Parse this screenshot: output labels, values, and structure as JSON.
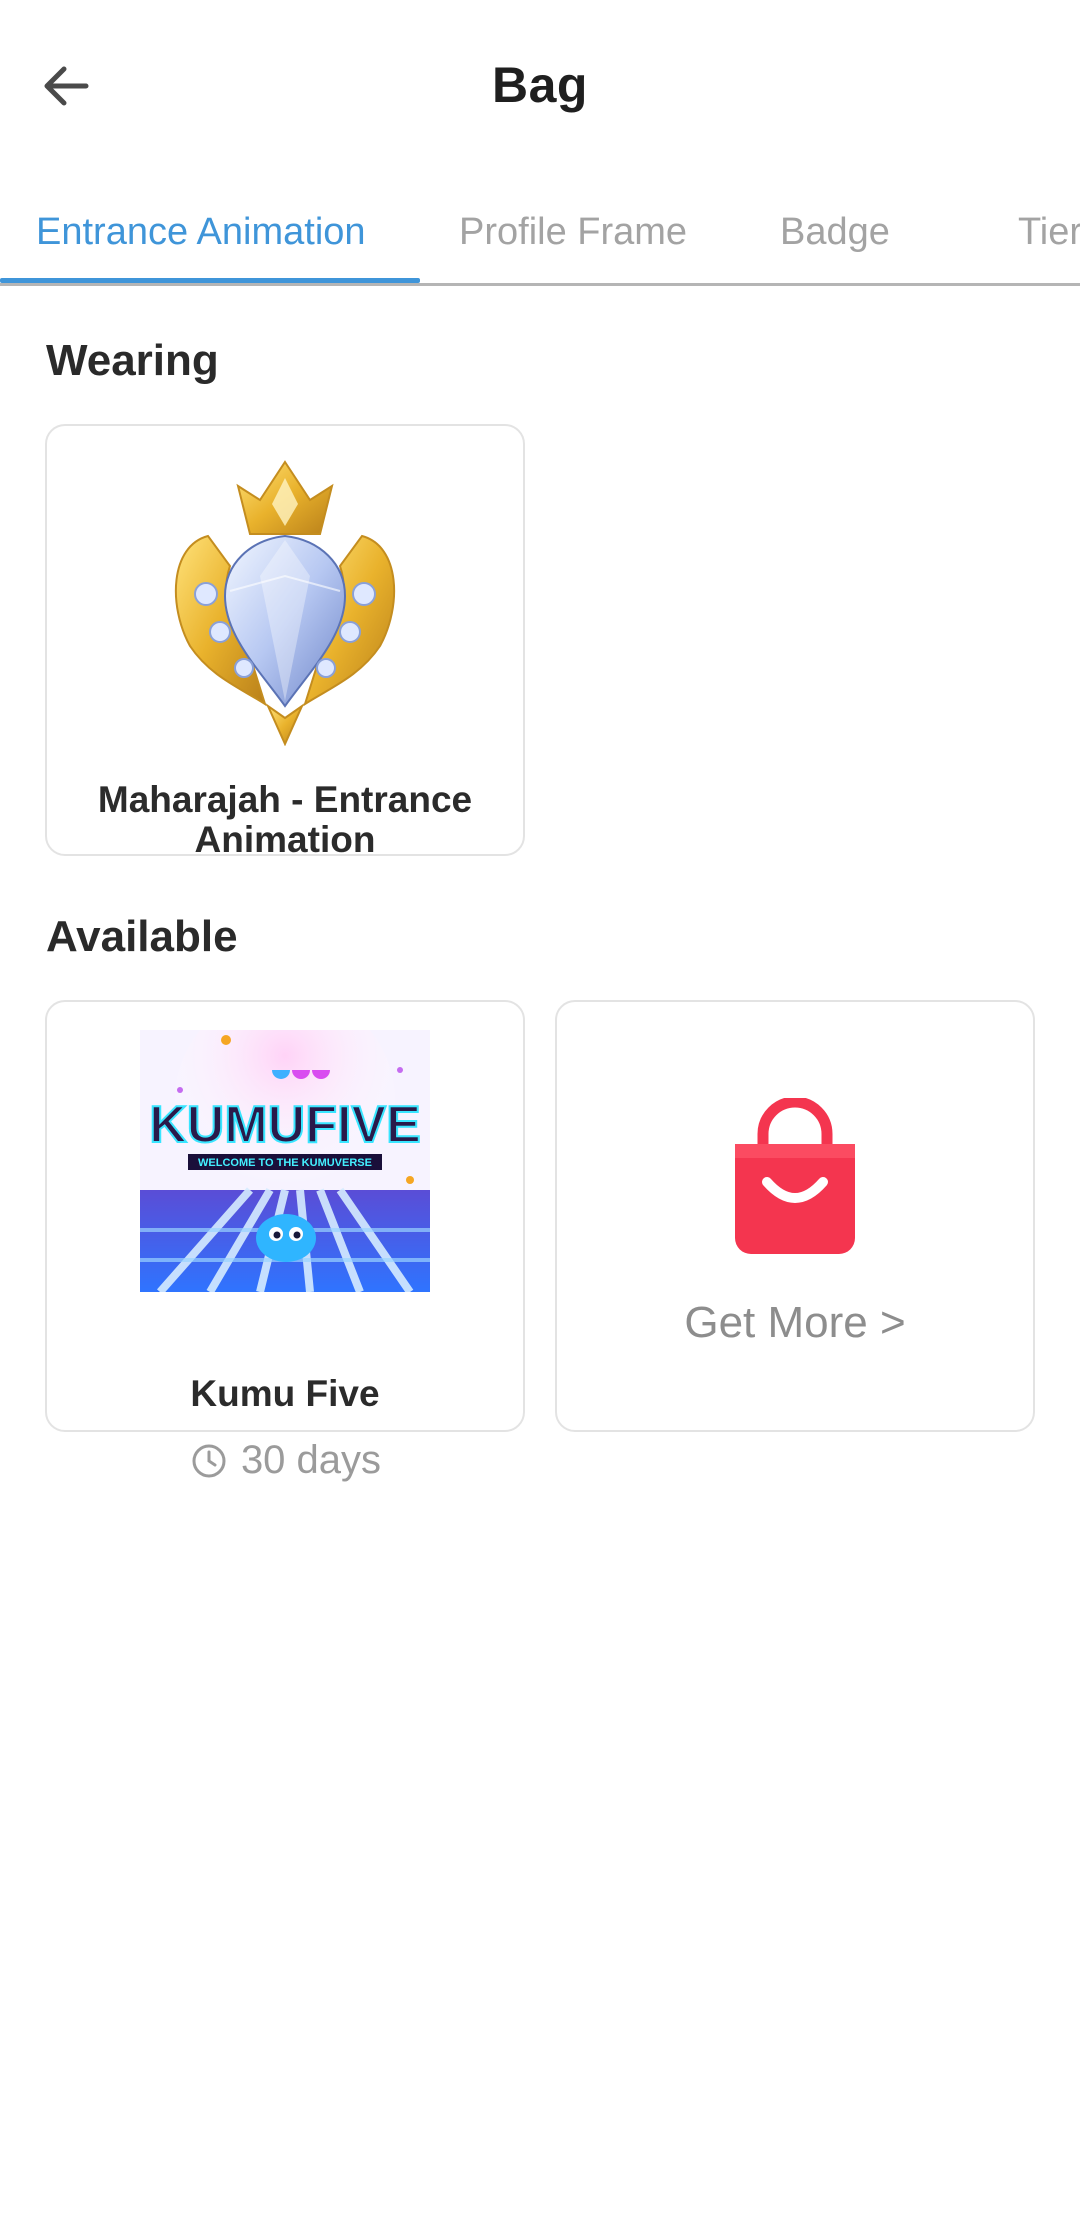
{
  "header": {
    "title": "Bag",
    "back_icon": "arrow-left-icon"
  },
  "tabs": [
    {
      "label": "Entrance Animation",
      "active": true
    },
    {
      "label": "Profile Frame",
      "active": false
    },
    {
      "label": "Badge",
      "active": false
    },
    {
      "label": "Tier",
      "active": false
    }
  ],
  "sections": {
    "wearing": {
      "title": "Wearing",
      "items": [
        {
          "name": "Maharajah - Entrance Animation",
          "icon": "diamond-crest-icon"
        }
      ]
    },
    "available": {
      "title": "Available",
      "items": [
        {
          "name": "Kumu Five",
          "icon": "kumufive-banner-image",
          "banner_title": "KUMUFIVE",
          "banner_subtitle": "WELCOME TO THE KUMUVERSE",
          "duration": "30 days",
          "duration_icon": "clock-icon"
        }
      ],
      "get_more": {
        "label": "Get More >",
        "icon": "shopping-bag-icon"
      }
    }
  },
  "colors": {
    "accent": "#3f95d9",
    "tab_inactive": "#a3a3a3",
    "bag_red": "#f4354f"
  }
}
